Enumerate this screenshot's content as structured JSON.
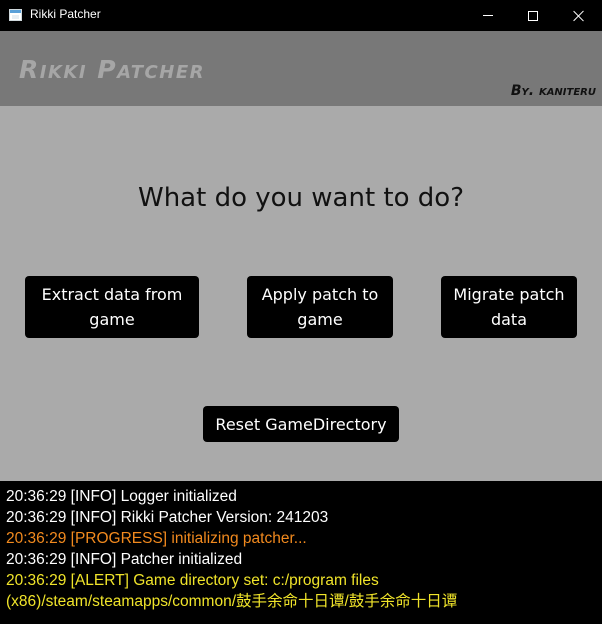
{
  "window": {
    "title": "Rikki Patcher"
  },
  "header": {
    "app_title": "Rikki Patcher",
    "author": "By. kaniteru"
  },
  "main": {
    "question": "What do you want to do?",
    "buttons": {
      "extract": "Extract data from game",
      "apply": "Apply patch to game",
      "migrate": "Migrate patch data",
      "reset": "Reset GameDirectory"
    }
  },
  "log": {
    "lines": [
      {
        "text": "20:36:29 [INFO] Logger initialized",
        "level": "info",
        "color": "#ffffff"
      },
      {
        "text": "20:36:29 [INFO] Rikki Patcher Version: 241203",
        "level": "info",
        "color": "#ffffff"
      },
      {
        "text": "20:36:29 [PROGRESS] initializing patcher...",
        "level": "progress",
        "color": "#f28a1e"
      },
      {
        "text": "20:36:29 [INFO] Patcher initialized",
        "level": "info",
        "color": "#ffffff"
      },
      {
        "text": "20:36:29 [ALERT] Game directory set: c:/program files (x86)/steam/steamapps/common/鼓手余命十日谭/鼓手余命十日谭",
        "level": "alert",
        "color": "#f0e42a"
      }
    ]
  },
  "colors": {
    "titlebar": "#000000",
    "header_band": "#787878",
    "content_bg": "#aaaaaa",
    "button_bg": "#000000",
    "console_bg": "#000000"
  },
  "icons": {
    "app": "app-window-icon",
    "minimize": "minimize-icon",
    "maximize": "maximize-icon",
    "close": "close-icon"
  }
}
